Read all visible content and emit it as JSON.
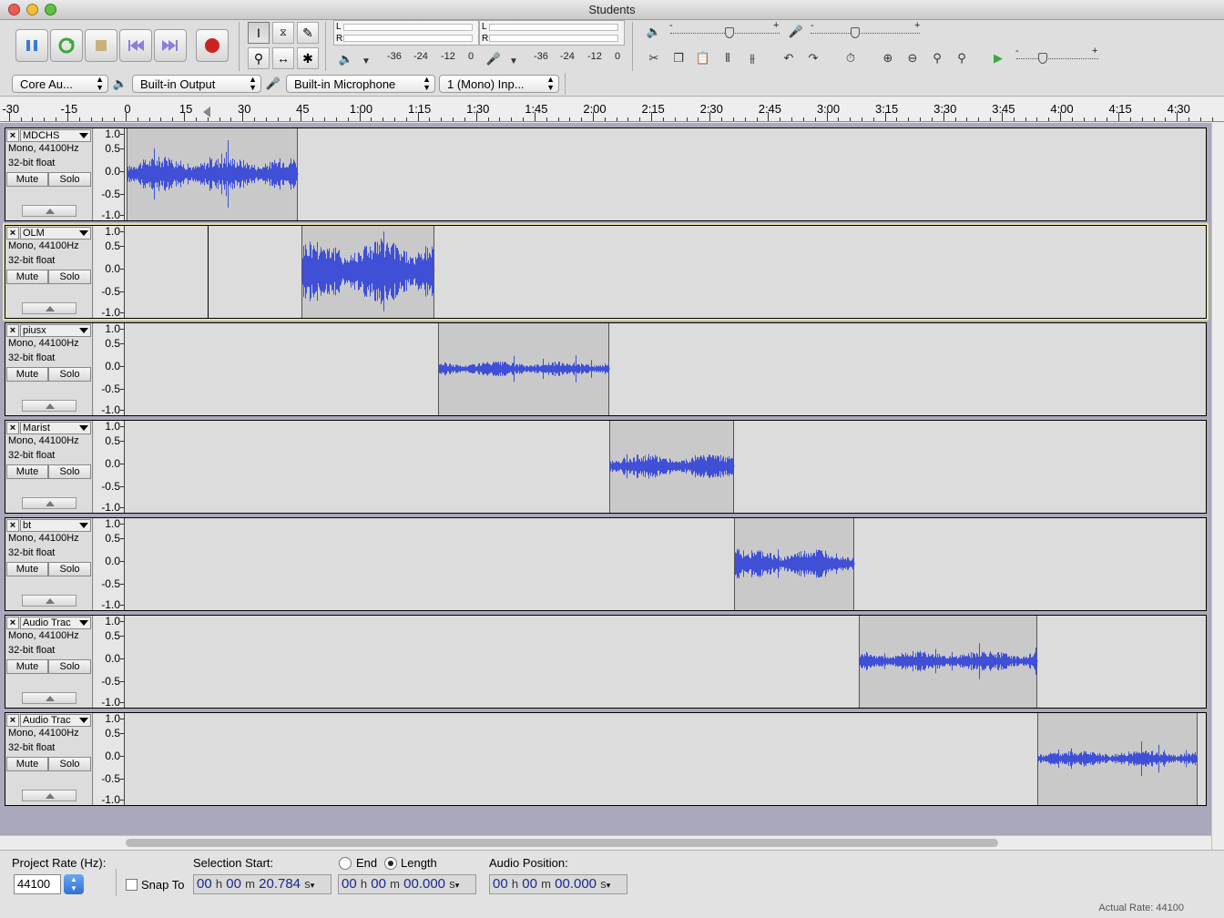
{
  "window": {
    "title": "Students"
  },
  "toolbar": {
    "transport": [
      "pause",
      "loop",
      "stop",
      "skip-start",
      "skip-end",
      "record"
    ],
    "meter_labels": {
      "left": "L",
      "right": "R"
    },
    "meter_scale": [
      "-36",
      "-24",
      "-12",
      "0"
    ],
    "slider_minus": "-",
    "slider_plus": "+"
  },
  "devices": {
    "host": "Core Au...",
    "output": "Built-in Output",
    "input": "Built-in Microphone",
    "channels": "1 (Mono) Inp..."
  },
  "ruler": {
    "labels": [
      "-30",
      "-15",
      "0",
      "15",
      "30",
      "45",
      "1:00",
      "1:15",
      "1:30",
      "1:45",
      "2:00",
      "2:15",
      "2:30",
      "2:45",
      "3:00",
      "3:15",
      "3:30",
      "3:45",
      "4:00",
      "4:15",
      "4:30"
    ],
    "seconds": [
      -30,
      -15,
      0,
      15,
      30,
      45,
      60,
      75,
      90,
      105,
      120,
      135,
      150,
      165,
      180,
      195,
      210,
      225,
      240,
      255,
      270
    ]
  },
  "vruler_labels": [
    "1.0",
    "0.5",
    "0.0",
    "-0.5",
    "-1.0"
  ],
  "tracks": [
    {
      "name": "MDCHS",
      "rate_info": "Mono, 44100Hz",
      "format_info": "32-bit float",
      "mute_label": "Mute",
      "solo_label": "Solo",
      "clip_start_s": 0,
      "clip_end_s": 44,
      "amplitude": 0.42,
      "selected": false
    },
    {
      "name": "OLM",
      "rate_info": "Mono, 44100Hz",
      "format_info": "32-bit float",
      "mute_label": "Mute",
      "solo_label": "Solo",
      "clip_start_s": 45,
      "clip_end_s": 79,
      "amplitude": 0.8,
      "selected": true
    },
    {
      "name": "piusx",
      "rate_info": "Mono, 44100Hz",
      "format_info": "32-bit float",
      "mute_label": "Mute",
      "solo_label": "Solo",
      "clip_start_s": 80,
      "clip_end_s": 124,
      "amplitude": 0.18,
      "selected": false
    },
    {
      "name": "Marist",
      "rate_info": "Mono, 44100Hz",
      "format_info": "32-bit float",
      "mute_label": "Mute",
      "solo_label": "Solo",
      "clip_start_s": 124,
      "clip_end_s": 156,
      "amplitude": 0.3,
      "selected": false
    },
    {
      "name": "bt",
      "rate_info": "Mono, 44100Hz",
      "format_info": "32-bit float",
      "mute_label": "Mute",
      "solo_label": "Solo",
      "clip_start_s": 156,
      "clip_end_s": 187,
      "amplitude": 0.35,
      "selected": false
    },
    {
      "name": "Audio Trac",
      "rate_info": "Mono, 44100Hz",
      "format_info": "32-bit float",
      "mute_label": "Mute",
      "solo_label": "Solo",
      "clip_start_s": 188,
      "clip_end_s": 234,
      "amplitude": 0.25,
      "selected": false
    },
    {
      "name": "Audio Trac",
      "rate_info": "Mono, 44100Hz",
      "format_info": "32-bit float",
      "mute_label": "Mute",
      "solo_label": "Solo",
      "clip_start_s": 234,
      "clip_end_s": 275,
      "amplitude": 0.2,
      "selected": false
    }
  ],
  "cursor_position_s": 20.784,
  "selection_toolbar": {
    "project_rate_label": "Project Rate (Hz):",
    "project_rate_value": "44100",
    "snap_to_label": "Snap To",
    "selection_start_label": "Selection Start:",
    "end_label": "End",
    "length_label": "Length",
    "audio_position_label": "Audio Position:",
    "selection_start": {
      "h": "00",
      "m": "00",
      "s": "20.784"
    },
    "length": {
      "h": "00",
      "m": "00",
      "s": "00.000"
    },
    "audio_position": {
      "h": "00",
      "m": "00",
      "s": "00.000"
    },
    "unit_h": "h",
    "unit_m": "m",
    "unit_s": "s"
  },
  "status": {
    "actual_rate": "Actual Rate: 44100"
  },
  "colors": {
    "waveform": "#3f4fd6",
    "clip_bg": "#c9c9c9",
    "track_bg": "#dcdcdc",
    "selected_outline": "#e9e1a0",
    "record": "#cc2222"
  }
}
